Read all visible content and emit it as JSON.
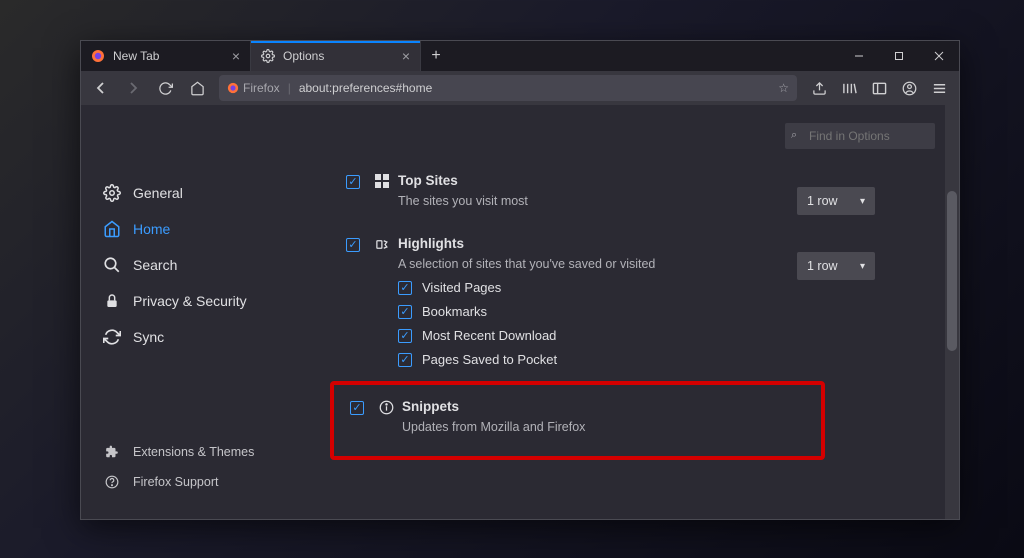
{
  "tabs": [
    {
      "label": "New Tab",
      "active": false
    },
    {
      "label": "Options",
      "active": true
    }
  ],
  "urlbar": {
    "identity": "Firefox",
    "url": "about:preferences#home"
  },
  "searchPlaceholder": "Find in Options",
  "sidebar": {
    "items": [
      {
        "label": "General"
      },
      {
        "label": "Home"
      },
      {
        "label": "Search"
      },
      {
        "label": "Privacy & Security"
      },
      {
        "label": "Sync"
      }
    ],
    "bottom": [
      {
        "label": "Extensions & Themes"
      },
      {
        "label": "Firefox Support"
      }
    ]
  },
  "sections": {
    "topSites": {
      "title": "Top Sites",
      "desc": "The sites you visit most",
      "rows": "1 row"
    },
    "highlights": {
      "title": "Highlights",
      "desc": "A selection of sites that you've saved or visited",
      "rows": "1 row",
      "items": [
        "Visited Pages",
        "Bookmarks",
        "Most Recent Download",
        "Pages Saved to Pocket"
      ]
    },
    "snippets": {
      "title": "Snippets",
      "desc": "Updates from Mozilla and Firefox"
    }
  }
}
